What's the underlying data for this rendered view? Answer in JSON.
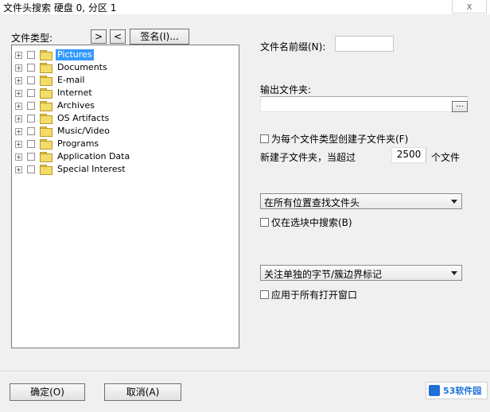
{
  "window": {
    "title": "文件头搜索 硬盘 0, 分区 1",
    "close_label": "x"
  },
  "left": {
    "file_types_label": "文件类型:",
    "next_button": ">",
    "prev_button": "<",
    "signature_button": "签名(I)...",
    "tree_items": [
      {
        "label": "Pictures",
        "selected": true
      },
      {
        "label": "Documents",
        "selected": false
      },
      {
        "label": "E-mail",
        "selected": false
      },
      {
        "label": "Internet",
        "selected": false
      },
      {
        "label": "Archives",
        "selected": false
      },
      {
        "label": "OS Artifacts",
        "selected": false
      },
      {
        "label": "Music/Video",
        "selected": false
      },
      {
        "label": "Programs",
        "selected": false
      },
      {
        "label": "Application Data",
        "selected": false
      },
      {
        "label": "Special Interest",
        "selected": false
      }
    ],
    "expander_glyph": "+"
  },
  "right": {
    "filename_prefix_label": "文件名前缀(N):",
    "filename_prefix_value": "",
    "output_folder_label": "输出文件夹:",
    "output_folder_value": "",
    "browse_button": "...",
    "create_subfolder_label": "为每个文件类型创建子文件夹(F)",
    "new_subfolder_label": "新建子文件夹，当超过",
    "new_subfolder_value": "2500",
    "files_unit_label": "个文件",
    "search_location_value": "在所有位置查找文件头",
    "selection_only_label": "仅在选块中搜索(B)",
    "boundary_value": "关注单独的字节/簇边界标记",
    "apply_all_label": "应用于所有打开窗口"
  },
  "footer": {
    "ok_button": "确定(O)",
    "cancel_button": "取消(A)"
  },
  "watermark": {
    "logo_text": "53软件园"
  }
}
